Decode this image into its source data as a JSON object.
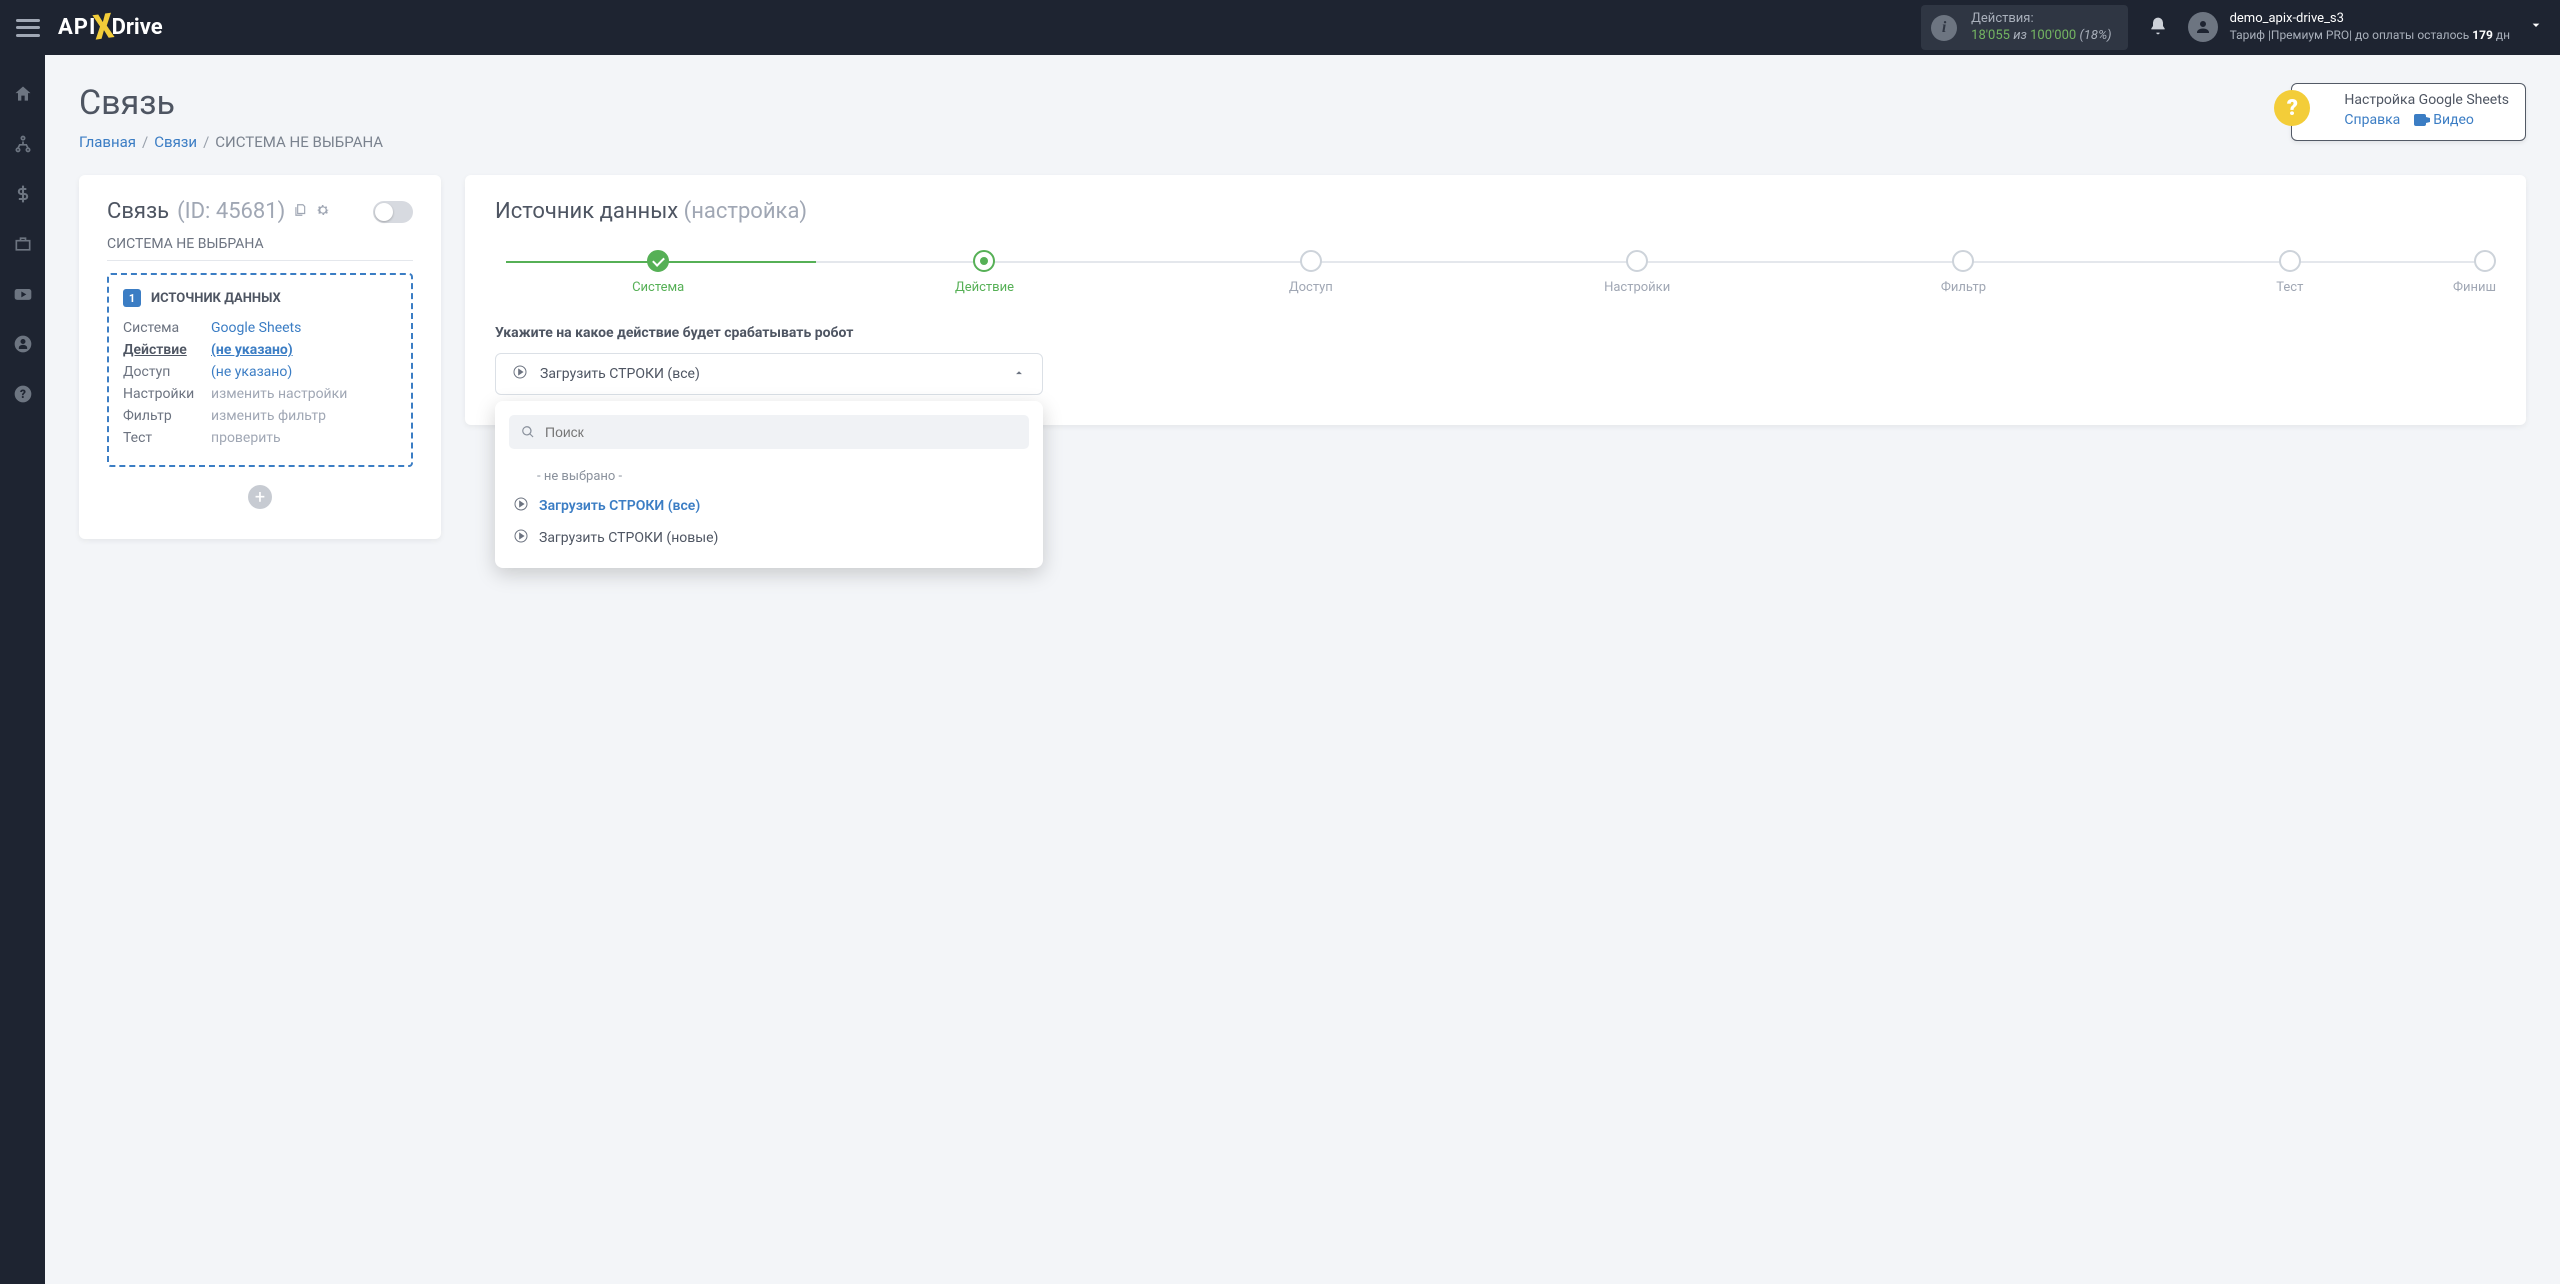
{
  "header": {
    "logo_api": "API",
    "logo_drive": "Drive",
    "actions_label": "Действия:",
    "actions_used": "18'055",
    "actions_iz": "из",
    "actions_total": "100'000",
    "actions_pct": "(18%)",
    "username": "demo_apix-drive_s3",
    "tariff_prefix": "Тариф |Премиум PRO| до оплаты осталось ",
    "days": "179",
    "tariff_suffix": " дн"
  },
  "page": {
    "title": "Связь",
    "bc_home": "Главная",
    "bc_conn": "Связи",
    "bc_current": "СИСТЕМА НЕ ВЫБРАНА"
  },
  "help": {
    "title": "Настройка Google Sheets",
    "help_link": "Справка",
    "video_link": "Видео"
  },
  "left": {
    "title": "Связь",
    "id": "(ID: 45681)",
    "sysname": "СИСТЕМА НЕ ВЫБРАНА",
    "badge": "1",
    "section_title": "ИСТОЧНИК ДАННЫХ",
    "rows": {
      "system_label": "Система",
      "system_value": "Google Sheets",
      "action_label": "Действие",
      "action_value": "(не указано)",
      "access_label": "Доступ",
      "access_value": "(не указано)",
      "settings_label": "Настройки",
      "settings_value": "изменить настройки",
      "filter_label": "Фильтр",
      "filter_value": "изменить фильтр",
      "test_label": "Тест",
      "test_value": "проверить"
    }
  },
  "right": {
    "h2_main": "Источник данных",
    "h2_sub": "(настройка)",
    "steps": {
      "system": "Система",
      "action": "Действие",
      "access": "Доступ",
      "settings": "Настройки",
      "filter": "Фильтр",
      "test": "Тест",
      "finish": "Финиш"
    },
    "field_label": "Укажите на какое действие будет срабатывать робот",
    "selected": "Загрузить СТРОКИ (все)",
    "search_placeholder": "Поиск",
    "opt_none": "- не выбрано -",
    "opt_all": "Загрузить СТРОКИ (все)",
    "opt_new": "Загрузить СТРОКИ (новые)"
  }
}
